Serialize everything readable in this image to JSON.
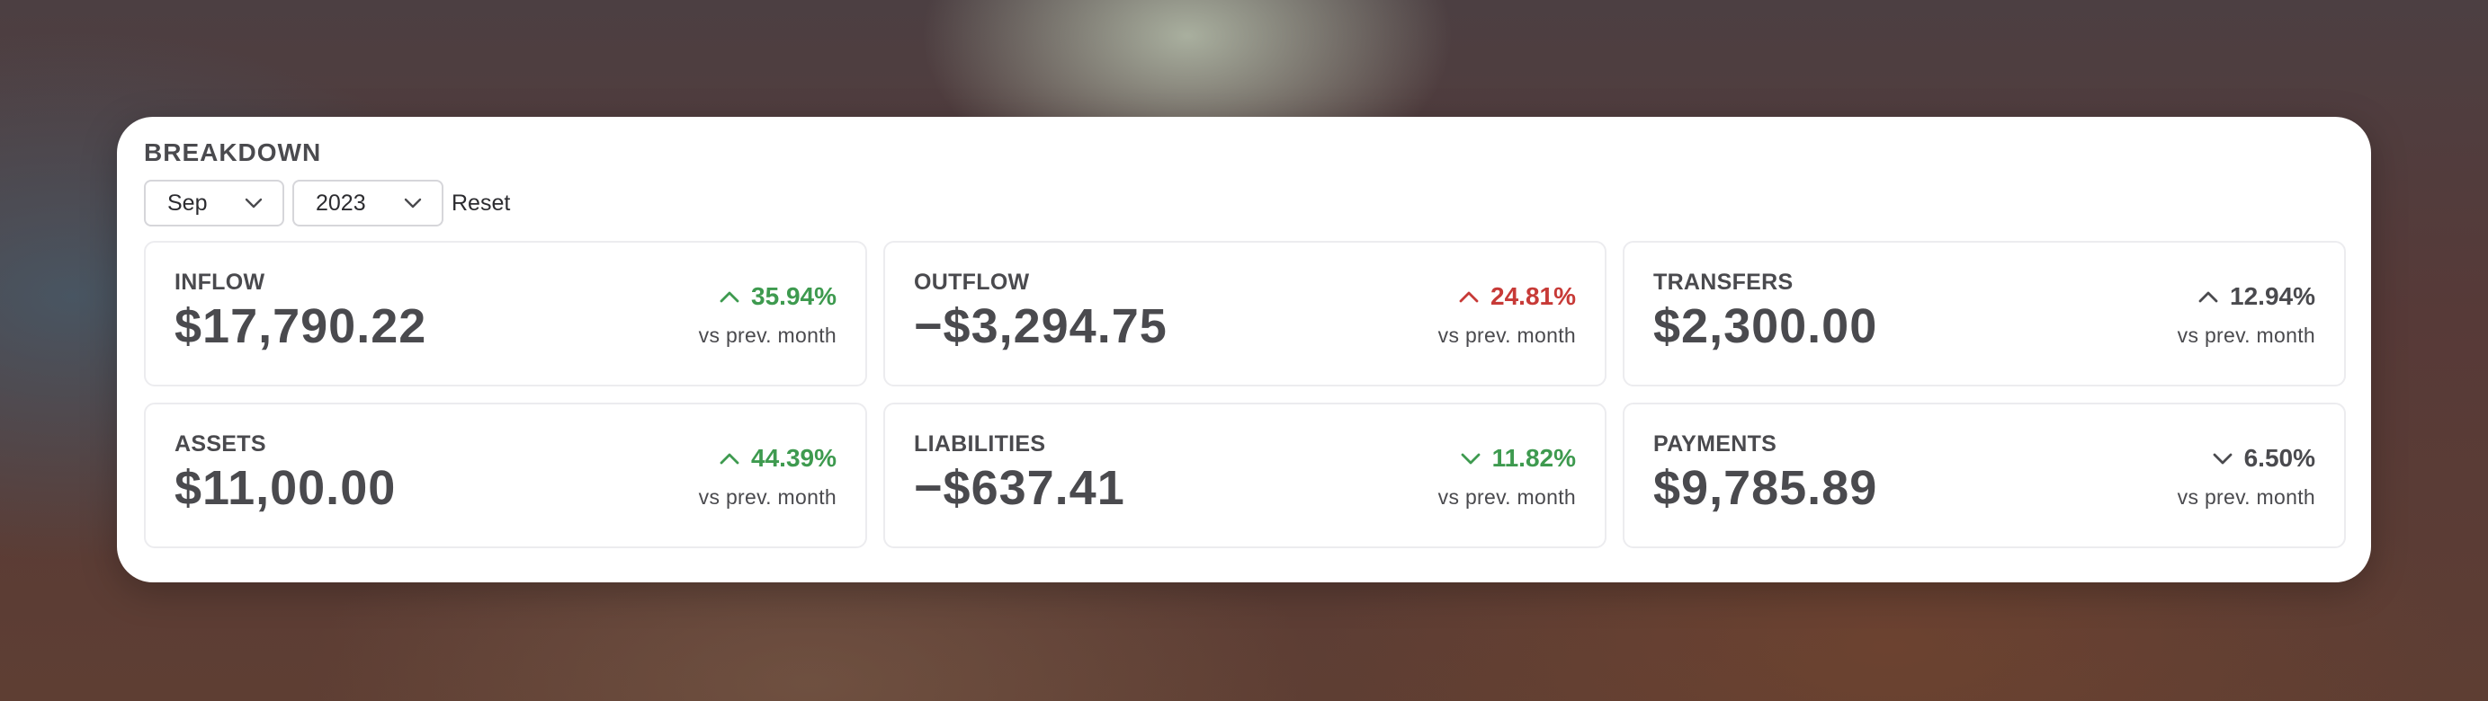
{
  "panel": {
    "title": "BREAKDOWN"
  },
  "controls": {
    "month": "Sep",
    "year": "2023",
    "reset_label": "Reset"
  },
  "colors": {
    "positive": "#3e9a4f",
    "negative": "#c73a37",
    "neutral": "#4a4a4e"
  },
  "cards": [
    {
      "label": "INFLOW",
      "value": "$17,790.22",
      "delta": "35.94%",
      "direction": "up",
      "tone": "green",
      "compare": "vs prev. month"
    },
    {
      "label": "OUTFLOW",
      "value": "−$3,294.75",
      "delta": "24.81%",
      "direction": "up",
      "tone": "red",
      "compare": "vs prev. month"
    },
    {
      "label": "TRANSFERS",
      "value": "$2,300.00",
      "delta": "12.94%",
      "direction": "up",
      "tone": "neutral",
      "compare": "vs prev. month"
    },
    {
      "label": "ASSETS",
      "value": "$11,00.00",
      "delta": "44.39%",
      "direction": "up",
      "tone": "green",
      "compare": "vs prev. month"
    },
    {
      "label": "LIABILITIES",
      "value": "−$637.41",
      "delta": "11.82%",
      "direction": "down",
      "tone": "green",
      "compare": "vs prev. month"
    },
    {
      "label": "PAYMENTS",
      "value": "$9,785.89",
      "delta": "6.50%",
      "direction": "down",
      "tone": "neutral",
      "compare": "vs prev. month"
    }
  ]
}
